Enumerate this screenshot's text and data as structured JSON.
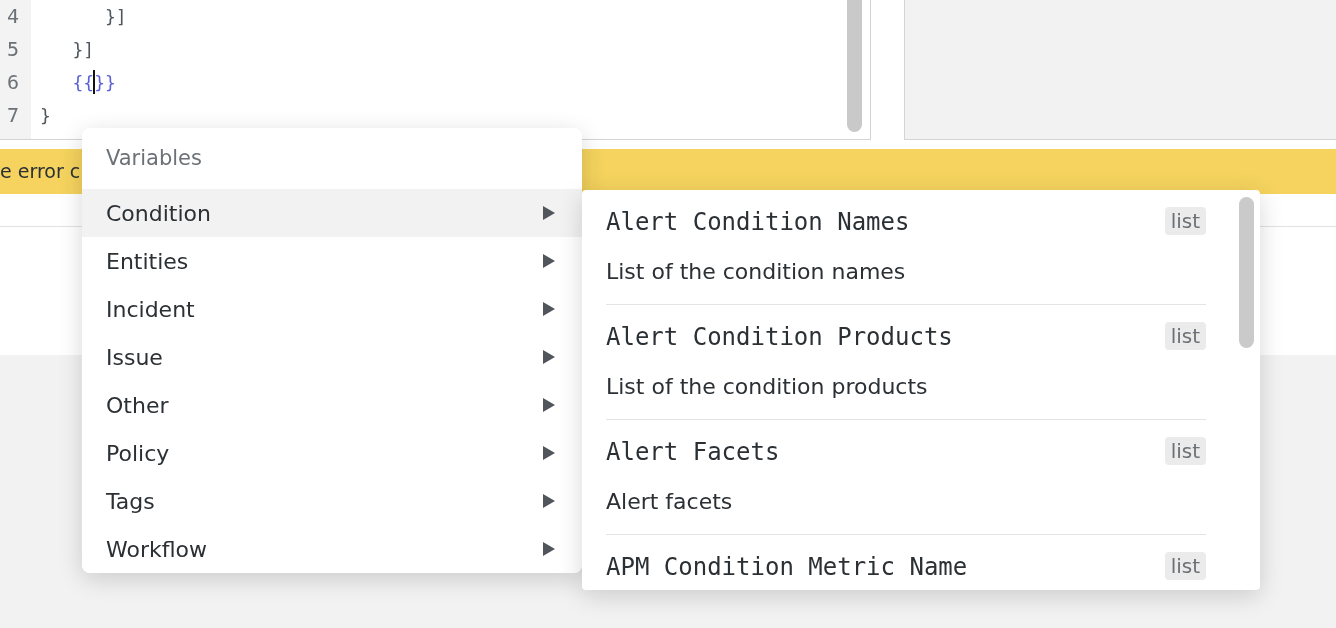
{
  "editor": {
    "lines": [
      {
        "number": "4",
        "code": "      }]",
        "kind": "plain",
        "cursor": false
      },
      {
        "number": "5",
        "code": "   }]",
        "kind": "plain",
        "cursor": false
      },
      {
        "number": "6",
        "code": "   {{",
        "code_after_cursor": "}}",
        "kind": "template",
        "cursor": true
      },
      {
        "number": "7",
        "code": "}",
        "kind": "plain",
        "cursor": false
      }
    ]
  },
  "banner": {
    "text": "e error c"
  },
  "variables_menu": {
    "header": "Variables",
    "items": [
      {
        "label": "Condition",
        "selected": true
      },
      {
        "label": "Entities",
        "selected": false
      },
      {
        "label": "Incident",
        "selected": false
      },
      {
        "label": "Issue",
        "selected": false
      },
      {
        "label": "Other",
        "selected": false
      },
      {
        "label": "Policy",
        "selected": false
      },
      {
        "label": "Tags",
        "selected": false
      },
      {
        "label": "Workflow",
        "selected": false
      }
    ]
  },
  "submenu": {
    "items": [
      {
        "name": "Alert Condition Names",
        "type": "list",
        "description": "List of the condition names"
      },
      {
        "name": "Alert Condition Products",
        "type": "list",
        "description": "List of the condition products"
      },
      {
        "name": "Alert Facets",
        "type": "list",
        "description": "Alert facets"
      },
      {
        "name": "APM Condition Metric Name",
        "type": "list"
      }
    ]
  }
}
